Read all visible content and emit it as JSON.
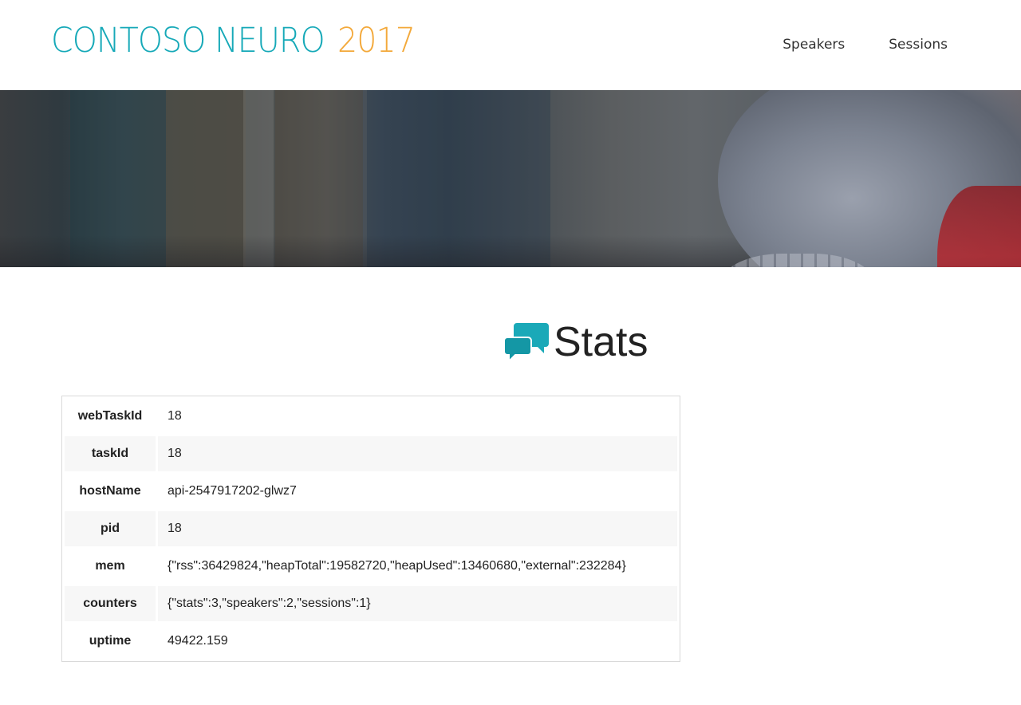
{
  "header": {
    "logo_text": "CONTOSO NEURO",
    "logo_year": "2017",
    "nav": [
      {
        "label": "Speakers"
      },
      {
        "label": "Sessions"
      }
    ]
  },
  "colors": {
    "brand_teal": "#16a9b8",
    "brand_orange": "#f3a93b",
    "row_alt_bg": "#f7f7f7"
  },
  "icons": {
    "title_icon": "chat-bubbles-icon"
  },
  "page": {
    "title": "Stats"
  },
  "stats": {
    "rows": [
      {
        "key": "webTaskId",
        "value": "18"
      },
      {
        "key": "taskId",
        "value": "18"
      },
      {
        "key": "hostName",
        "value": "api-2547917202-glwz7"
      },
      {
        "key": "pid",
        "value": "18"
      },
      {
        "key": "mem",
        "value": "{\"rss\":36429824,\"heapTotal\":19582720,\"heapUsed\":13460680,\"external\":232284}"
      },
      {
        "key": "counters",
        "value": "{\"stats\":3,\"speakers\":2,\"sessions\":1}"
      },
      {
        "key": "uptime",
        "value": "49422.159"
      }
    ]
  }
}
